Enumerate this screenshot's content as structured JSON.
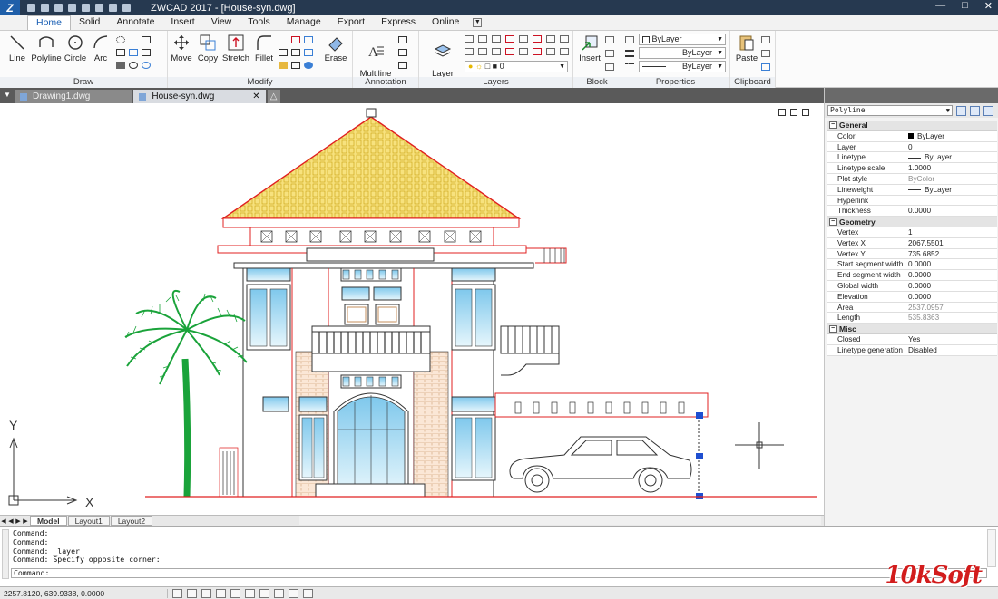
{
  "window": {
    "title": "ZWCAD 2017 - [House-syn.dwg]",
    "logo": "Z"
  },
  "menu": {
    "tabs": [
      "Home",
      "Solid",
      "Annotate",
      "Insert",
      "View",
      "Tools",
      "Manage",
      "Export",
      "Express",
      "Online"
    ],
    "active": "Home"
  },
  "ribbon": {
    "draw": {
      "title": "Draw",
      "line": "Line",
      "polyline": "Polyline",
      "circle": "Circle",
      "arc": "Arc"
    },
    "modify": {
      "title": "Modify",
      "move": "Move",
      "copy": "Copy",
      "stretch": "Stretch",
      "fillet": "Fillet",
      "erase": "Erase"
    },
    "annotation": {
      "title": "Annotation",
      "mtext": "Multiline\nText"
    },
    "layers": {
      "title": "Layers",
      "layer_properties": "Layer\nProperties",
      "layer_combo": "0"
    },
    "block": {
      "title": "Block",
      "insert": "Insert"
    },
    "properties": {
      "title": "Properties",
      "color": "ByLayer",
      "linetype": "ByLayer",
      "lineweight": "ByLayer"
    },
    "clipboard": {
      "title": "Clipboard",
      "paste": "Paste"
    }
  },
  "documents": {
    "tabs": [
      {
        "name": "Drawing1.dwg",
        "active": false
      },
      {
        "name": "House-syn.dwg",
        "active": true
      }
    ]
  },
  "layouts": [
    "Model",
    "Layout1",
    "Layout2"
  ],
  "properties_panel": {
    "selection": "Polyline",
    "categories": [
      {
        "name": "General",
        "rows": [
          {
            "k": "Color",
            "v": "ByLayer",
            "swatch": "#000000"
          },
          {
            "k": "Layer",
            "v": "0"
          },
          {
            "k": "Linetype",
            "v": "ByLayer",
            "line": true
          },
          {
            "k": "Linetype scale",
            "v": "1.0000"
          },
          {
            "k": "Plot style",
            "v": "ByColor",
            "ro": true
          },
          {
            "k": "Lineweight",
            "v": "ByLayer",
            "line": true
          },
          {
            "k": "Hyperlink",
            "v": ""
          },
          {
            "k": "Thickness",
            "v": "0.0000"
          }
        ]
      },
      {
        "name": "Geometry",
        "rows": [
          {
            "k": "Vertex",
            "v": "1"
          },
          {
            "k": "Vertex X",
            "v": "2067.5501"
          },
          {
            "k": "Vertex Y",
            "v": "735.6852"
          },
          {
            "k": "Start segment width",
            "v": "0.0000"
          },
          {
            "k": "End segment width",
            "v": "0.0000"
          },
          {
            "k": "Global width",
            "v": "0.0000"
          },
          {
            "k": "Elevation",
            "v": "0.0000"
          },
          {
            "k": "Area",
            "v": "2537.0957",
            "ro": true
          },
          {
            "k": "Length",
            "v": "535.8363",
            "ro": true
          }
        ]
      },
      {
        "name": "Misc",
        "rows": [
          {
            "k": "Closed",
            "v": "Yes"
          },
          {
            "k": "Linetype generation",
            "v": "Disabled"
          }
        ]
      }
    ]
  },
  "command": {
    "history": [
      "Command:",
      "Command:",
      "Command: _layer",
      "Command: Specify opposite corner:"
    ],
    "prompt": "Command:"
  },
  "ucs": {
    "x": "X",
    "y": "Y"
  },
  "status": {
    "coords": "2257.8120, 639.9338, 0.0000"
  },
  "watermark": "10kSoft",
  "colors": {
    "titlebar": "#263950",
    "accent": "#1a5fb4",
    "drawing_red": "#e02020",
    "roof_fill": "#f5dd6a",
    "glass": "#bfe6f5"
  }
}
